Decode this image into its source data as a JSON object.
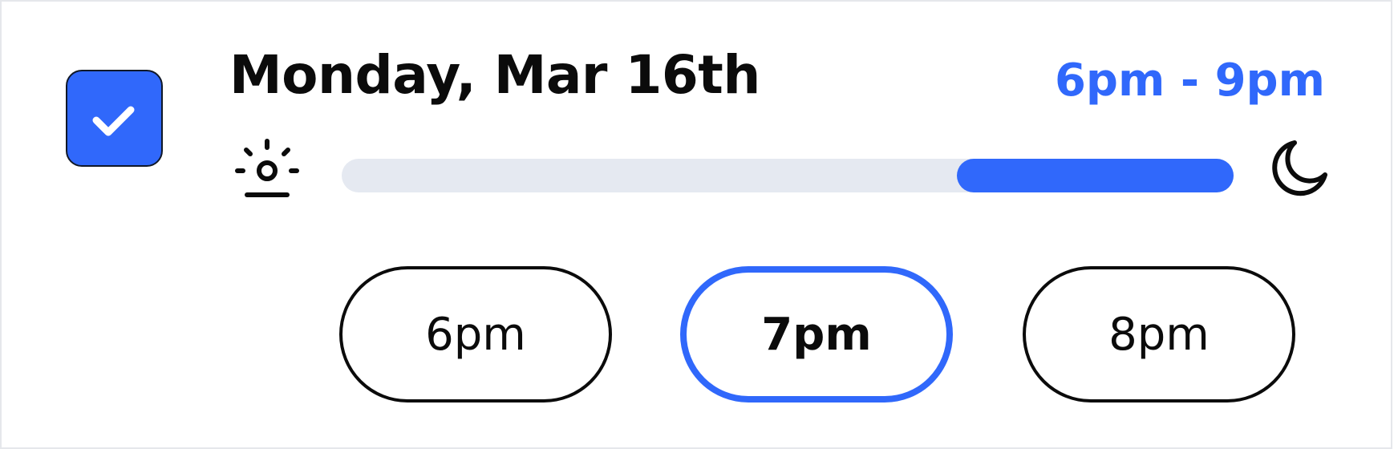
{
  "slot": {
    "checked": true,
    "date": "Monday, Mar 16th",
    "range": "6pm - 9pm",
    "accent_color": "#3068fb",
    "start_icon": "sunrise-icon",
    "end_icon": "moon-icon",
    "day_progress": {
      "selected_start_fraction": 0.69,
      "selected_end_fraction": 1.0
    },
    "times": [
      {
        "label": "6pm",
        "selected": false
      },
      {
        "label": "7pm",
        "selected": true
      },
      {
        "label": "8pm",
        "selected": false
      }
    ]
  }
}
